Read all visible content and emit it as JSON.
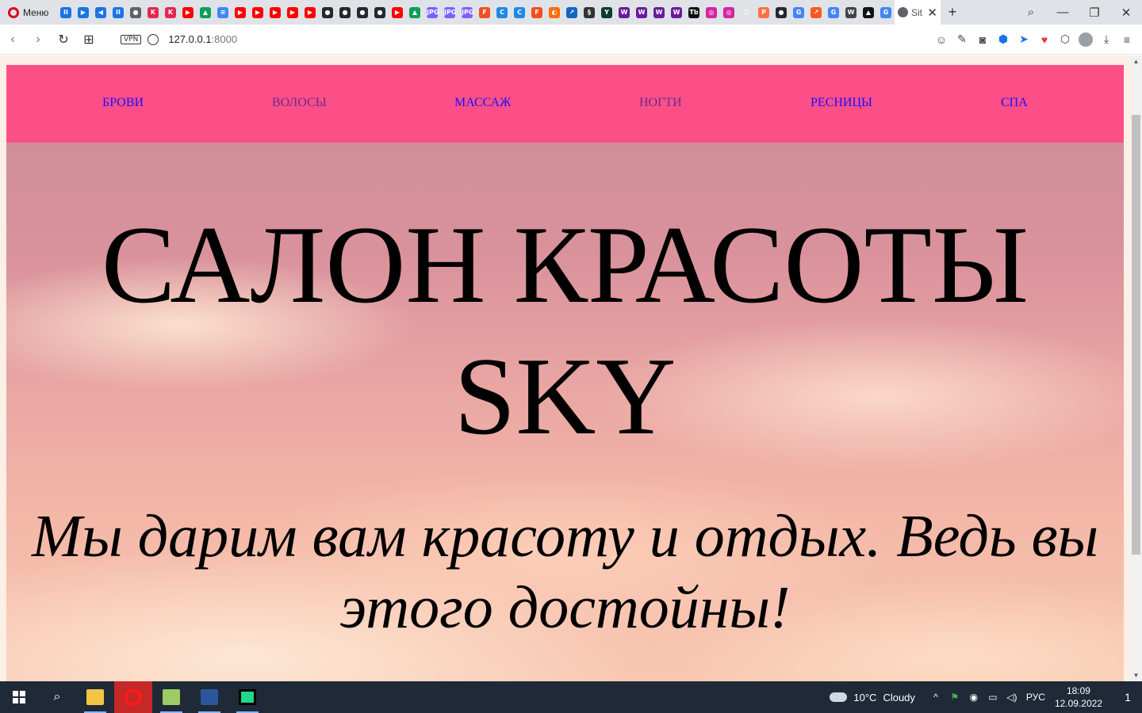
{
  "browser": {
    "menu_label": "Меню",
    "active_tab_title": "Sit",
    "url_host": "127.0.0.1",
    "url_port": ":8000",
    "vpn_label": "VPN",
    "pinned_tabs": [
      {
        "icon": "pause-icon",
        "color": "#1a73e8",
        "text": "II"
      },
      {
        "icon": "play-icon",
        "color": "#1a73e8",
        "text": "▶"
      },
      {
        "icon": "sound-icon",
        "color": "#1a73e8",
        "text": "◀"
      },
      {
        "icon": "pause-icon",
        "color": "#1a73e8",
        "text": "II"
      },
      {
        "icon": "globe-icon",
        "color": "#5f6368",
        "text": "●"
      },
      {
        "icon": "k-icon",
        "color": "#e6264f",
        "text": "K"
      },
      {
        "icon": "k-icon",
        "color": "#e6264f",
        "text": "K"
      },
      {
        "icon": "youtube-icon",
        "color": "#ff0000",
        "text": "▶"
      },
      {
        "icon": "drive-icon",
        "color": "#0f9d58",
        "text": "▲"
      },
      {
        "icon": "docs-icon",
        "color": "#4285f4",
        "text": "≡"
      },
      {
        "icon": "youtube-icon",
        "color": "#ff0000",
        "text": "▶"
      },
      {
        "icon": "youtube-icon",
        "color": "#ff0000",
        "text": "▶"
      },
      {
        "icon": "youtube-icon",
        "color": "#ff0000",
        "text": "▶"
      },
      {
        "icon": "youtube-icon",
        "color": "#ff0000",
        "text": "▶"
      },
      {
        "icon": "youtube-icon",
        "color": "#ff0000",
        "text": "▶"
      },
      {
        "icon": "github-icon",
        "color": "#24292e",
        "text": "●"
      },
      {
        "icon": "github-icon",
        "color": "#24292e",
        "text": "●"
      },
      {
        "icon": "github-icon",
        "color": "#24292e",
        "text": "●"
      },
      {
        "icon": "github-icon",
        "color": "#24292e",
        "text": "●"
      },
      {
        "icon": "youtube-icon",
        "color": "#ff0000",
        "text": "▶"
      },
      {
        "icon": "drive-icon",
        "color": "#0f9d58",
        "text": "▲"
      },
      {
        "icon": "jpg-icon",
        "color": "#7b61ff",
        "text": "JPG"
      },
      {
        "icon": "jpg-icon",
        "color": "#7b61ff",
        "text": "JPG"
      },
      {
        "icon": "jpg-icon",
        "color": "#7b61ff",
        "text": "JPG"
      },
      {
        "icon": "figma-icon",
        "color": "#f24e1e",
        "text": "F"
      },
      {
        "icon": "c-icon",
        "color": "#1e88e5",
        "text": "C"
      },
      {
        "icon": "c-icon",
        "color": "#1e88e5",
        "text": "C"
      },
      {
        "icon": "figma-icon",
        "color": "#f24e1e",
        "text": "F"
      },
      {
        "icon": "orbit-icon",
        "color": "#ff6d00",
        "text": "◐"
      },
      {
        "icon": "chart-icon",
        "color": "#1565c0",
        "text": "↗"
      },
      {
        "icon": "link-icon",
        "color": "#333333",
        "text": "§"
      },
      {
        "icon": "y-icon",
        "color": "#0b3d2e",
        "text": "Y"
      },
      {
        "icon": "w-icon",
        "color": "#6a1b9a",
        "text": "W"
      },
      {
        "icon": "w-icon",
        "color": "#6a1b9a",
        "text": "W"
      },
      {
        "icon": "w-icon",
        "color": "#6a1b9a",
        "text": "W"
      },
      {
        "icon": "w-icon",
        "color": "#6a1b9a",
        "text": "W"
      },
      {
        "icon": "tb-icon",
        "color": "#111111",
        "text": "Tb"
      },
      {
        "icon": "instagram-icon",
        "color": "#d6249f",
        "text": "◎"
      },
      {
        "icon": "instagram-icon",
        "color": "#d6249f",
        "text": "◎"
      },
      {
        "icon": "emoji-icon",
        "color": "#e0e0e0",
        "text": "☺"
      },
      {
        "icon": "pptx-icon",
        "color": "#ff7043",
        "text": "P"
      },
      {
        "icon": "github-icon",
        "color": "#24292e",
        "text": "●"
      },
      {
        "icon": "google-icon",
        "color": "#4285f4",
        "text": "G"
      },
      {
        "icon": "arrow-icon",
        "color": "#ff5722",
        "text": "↗"
      },
      {
        "icon": "google-icon",
        "color": "#4285f4",
        "text": "G"
      },
      {
        "icon": "wikipedia-icon",
        "color": "#444444",
        "text": "W"
      },
      {
        "icon": "a-icon",
        "color": "#111111",
        "text": "▲"
      },
      {
        "icon": "google-icon",
        "color": "#4285f4",
        "text": "G"
      }
    ]
  },
  "site": {
    "nav": [
      {
        "label": "БРОВИ"
      },
      {
        "label": "ВОЛОСЫ"
      },
      {
        "label": "МАССАЖ"
      },
      {
        "label": "НОГТИ"
      },
      {
        "label": "РЕСНИЦЫ"
      },
      {
        "label": "СПА"
      }
    ],
    "hero_title": "САЛОН КРАСОТЫ SKY",
    "hero_subtitle": "Мы дарим вам красоту и отдых. Ведь вы этого достойны!",
    "colors": {
      "nav_background": "#fc4f88",
      "link": "#1a0dff",
      "visited_link": "#6b2b8f"
    }
  },
  "taskbar": {
    "weather_temp": "10°C",
    "weather_text": "Cloudy",
    "language": "РУС",
    "time": "18:09",
    "date": "12.09.2022",
    "notification_count": "1"
  }
}
